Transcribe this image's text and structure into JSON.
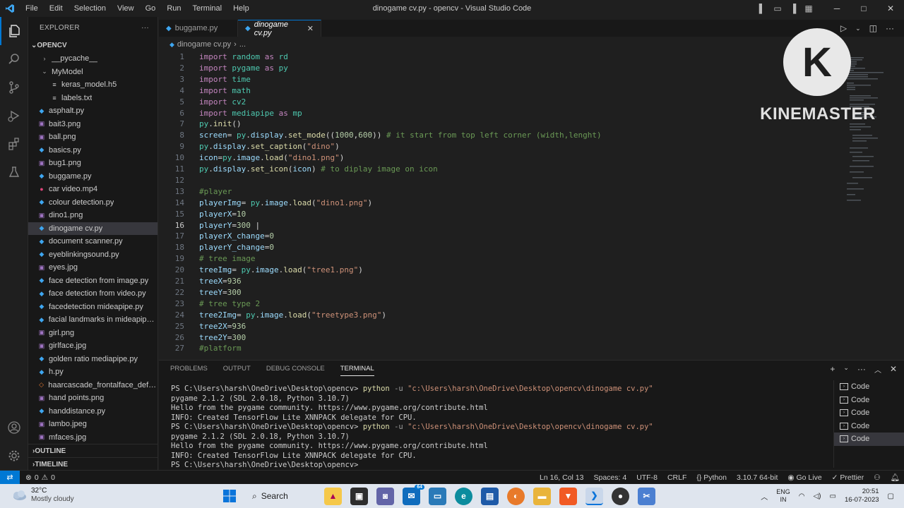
{
  "window": {
    "title": "dinogame cv.py - opencv - Visual Studio Code",
    "menu": [
      "File",
      "Edit",
      "Selection",
      "View",
      "Go",
      "Run",
      "Terminal",
      "Help"
    ]
  },
  "explorer": {
    "header": "EXPLORER",
    "root": "OPENCV",
    "items": [
      {
        "label": "__pycache__",
        "type": "folder-collapsed"
      },
      {
        "label": "MyModel",
        "type": "folder-open"
      },
      {
        "label": "keras_model.h5",
        "type": "file-h5"
      },
      {
        "label": "labels.txt",
        "type": "file-txt"
      },
      {
        "label": "asphalt.py",
        "type": "py"
      },
      {
        "label": "bait3.png",
        "type": "img"
      },
      {
        "label": "ball.png",
        "type": "img"
      },
      {
        "label": "basics.py",
        "type": "py"
      },
      {
        "label": "bug1.png",
        "type": "img"
      },
      {
        "label": "buggame.py",
        "type": "py"
      },
      {
        "label": "car video.mp4",
        "type": "video"
      },
      {
        "label": "colour detection.py",
        "type": "py"
      },
      {
        "label": "dino1.png",
        "type": "img"
      },
      {
        "label": "dinogame cv.py",
        "type": "py",
        "selected": true
      },
      {
        "label": "document scanner.py",
        "type": "py"
      },
      {
        "label": "eyeblinkingsound.py",
        "type": "py"
      },
      {
        "label": "eyes.jpg",
        "type": "img"
      },
      {
        "label": "face detection from image.py",
        "type": "py"
      },
      {
        "label": "face detection from video.py",
        "type": "py"
      },
      {
        "label": "facedetection mideapipe.py",
        "type": "py"
      },
      {
        "label": "facial landmarks in mideapipe ...",
        "type": "py"
      },
      {
        "label": "girl.png",
        "type": "img"
      },
      {
        "label": "girlface.jpg",
        "type": "img"
      },
      {
        "label": "golden ratio mediapipe.py",
        "type": "py"
      },
      {
        "label": "h.py",
        "type": "py"
      },
      {
        "label": "haarcascade_frontalface_defau...",
        "type": "xml"
      },
      {
        "label": "hand points.png",
        "type": "img"
      },
      {
        "label": "handdistance.py",
        "type": "py"
      },
      {
        "label": "lambo.jpeg",
        "type": "img"
      },
      {
        "label": "mfaces.jpg",
        "type": "img"
      }
    ],
    "outline": "OUTLINE",
    "timeline": "TIMELINE"
  },
  "tabs": [
    {
      "label": "buggame.py",
      "active": false
    },
    {
      "label": "dinogame cv.py",
      "active": true
    }
  ],
  "breadcrumb": [
    "dinogame cv.py",
    "..."
  ],
  "code_lines": [
    [
      [
        "k",
        "import "
      ],
      [
        "m",
        "random"
      ],
      [
        "k",
        " as "
      ],
      [
        "m",
        "rd"
      ]
    ],
    [
      [
        "k",
        "import "
      ],
      [
        "m",
        "pygame"
      ],
      [
        "k",
        " as "
      ],
      [
        "m",
        "py"
      ]
    ],
    [
      [
        "k",
        "import "
      ],
      [
        "m",
        "time"
      ]
    ],
    [
      [
        "k",
        "import "
      ],
      [
        "m",
        "math"
      ]
    ],
    [
      [
        "k",
        "import "
      ],
      [
        "m",
        "cv2"
      ]
    ],
    [
      [
        "k",
        "import "
      ],
      [
        "m",
        "mediapipe"
      ],
      [
        "k",
        " as "
      ],
      [
        "m",
        "mp"
      ]
    ],
    [
      [
        "m",
        "py"
      ],
      [
        "p",
        "."
      ],
      [
        "f",
        "init"
      ],
      [
        "p",
        "()"
      ]
    ],
    [
      [
        "v",
        "screen"
      ],
      [
        "p",
        "= "
      ],
      [
        "m",
        "py"
      ],
      [
        "p",
        "."
      ],
      [
        "v",
        "display"
      ],
      [
        "p",
        "."
      ],
      [
        "f",
        "set_mode"
      ],
      [
        "p",
        "(("
      ],
      [
        "n",
        "1000"
      ],
      [
        "p",
        ","
      ],
      [
        "n",
        "600"
      ],
      [
        "p",
        "))"
      ],
      [
        "c",
        " # it start from top left corner (width,lenght)"
      ]
    ],
    [
      [
        "m",
        "py"
      ],
      [
        "p",
        "."
      ],
      [
        "v",
        "display"
      ],
      [
        "p",
        "."
      ],
      [
        "f",
        "set_caption"
      ],
      [
        "p",
        "("
      ],
      [
        "s",
        "\"dino\""
      ],
      [
        "p",
        ")"
      ]
    ],
    [
      [
        "v",
        "icon"
      ],
      [
        "p",
        "="
      ],
      [
        "m",
        "py"
      ],
      [
        "p",
        "."
      ],
      [
        "v",
        "image"
      ],
      [
        "p",
        "."
      ],
      [
        "f",
        "load"
      ],
      [
        "p",
        "("
      ],
      [
        "s",
        "\"dino1.png\""
      ],
      [
        "p",
        ")"
      ]
    ],
    [
      [
        "m",
        "py"
      ],
      [
        "p",
        "."
      ],
      [
        "v",
        "display"
      ],
      [
        "p",
        "."
      ],
      [
        "f",
        "set_icon"
      ],
      [
        "p",
        "("
      ],
      [
        "v",
        "icon"
      ],
      [
        "p",
        ")"
      ],
      [
        "c",
        " # to diplay image on icon"
      ]
    ],
    [],
    [
      [
        "c",
        "#player"
      ]
    ],
    [
      [
        "v",
        "playerImg"
      ],
      [
        "p",
        "= "
      ],
      [
        "m",
        "py"
      ],
      [
        "p",
        "."
      ],
      [
        "v",
        "image"
      ],
      [
        "p",
        "."
      ],
      [
        "f",
        "load"
      ],
      [
        "p",
        "("
      ],
      [
        "s",
        "\"dino1.png\""
      ],
      [
        "p",
        ")"
      ]
    ],
    [
      [
        "v",
        "playerX"
      ],
      [
        "p",
        "="
      ],
      [
        "n",
        "10"
      ]
    ],
    [
      [
        "v",
        "playerY"
      ],
      [
        "p",
        "="
      ],
      [
        "n",
        "300"
      ],
      [
        "p",
        " |"
      ]
    ],
    [
      [
        "v",
        "playerX_change"
      ],
      [
        "p",
        "="
      ],
      [
        "n",
        "0"
      ]
    ],
    [
      [
        "v",
        "playerY_change"
      ],
      [
        "p",
        "="
      ],
      [
        "n",
        "0"
      ]
    ],
    [
      [
        "c",
        "# tree image"
      ]
    ],
    [
      [
        "v",
        "treeImg"
      ],
      [
        "p",
        "= "
      ],
      [
        "m",
        "py"
      ],
      [
        "p",
        "."
      ],
      [
        "v",
        "image"
      ],
      [
        "p",
        "."
      ],
      [
        "f",
        "load"
      ],
      [
        "p",
        "("
      ],
      [
        "s",
        "\"tree1.png\""
      ],
      [
        "p",
        ")"
      ]
    ],
    [
      [
        "v",
        "treeX"
      ],
      [
        "p",
        "="
      ],
      [
        "n",
        "936"
      ]
    ],
    [
      [
        "v",
        "treeY"
      ],
      [
        "p",
        "="
      ],
      [
        "n",
        "300"
      ]
    ],
    [
      [
        "c",
        "# tree type 2"
      ]
    ],
    [
      [
        "v",
        "tree2Img"
      ],
      [
        "p",
        "= "
      ],
      [
        "m",
        "py"
      ],
      [
        "p",
        "."
      ],
      [
        "v",
        "image"
      ],
      [
        "p",
        "."
      ],
      [
        "f",
        "load"
      ],
      [
        "p",
        "("
      ],
      [
        "s",
        "\"treetype3.png\""
      ],
      [
        "p",
        ")"
      ]
    ],
    [
      [
        "v",
        "tree2X"
      ],
      [
        "p",
        "="
      ],
      [
        "n",
        "936"
      ]
    ],
    [
      [
        "v",
        "tree2Y"
      ],
      [
        "p",
        "="
      ],
      [
        "n",
        "300"
      ]
    ],
    [
      [
        "c",
        "#platform"
      ]
    ]
  ],
  "current_line": 16,
  "watermark": {
    "letter": "K",
    "text": "KINEMASTER"
  },
  "panel": {
    "tabs": [
      "PROBLEMS",
      "OUTPUT",
      "DEBUG CONSOLE",
      "TERMINAL"
    ],
    "active_tab": "TERMINAL",
    "terminal_lines": [
      {
        "prompt": "PS C:\\Users\\harsh\\OneDrive\\Desktop\\opencv> ",
        "cmd": "python",
        "arg": " -u ",
        "str": "\"c:\\Users\\harsh\\OneDrive\\Desktop\\opencv\\dinogame cv.py\""
      },
      {
        "text": "pygame 2.1.2 (SDL 2.0.18, Python 3.10.7)"
      },
      {
        "text": "Hello from the pygame community. https://www.pygame.org/contribute.html"
      },
      {
        "text": "INFO: Created TensorFlow Lite XNNPACK delegate for CPU."
      },
      {
        "prompt": "PS C:\\Users\\harsh\\OneDrive\\Desktop\\opencv> ",
        "cmd": "python",
        "arg": " -u ",
        "str": "\"c:\\Users\\harsh\\OneDrive\\Desktop\\opencv\\dinogame cv.py\""
      },
      {
        "text": "pygame 2.1.2 (SDL 2.0.18, Python 3.10.7)"
      },
      {
        "text": "Hello from the pygame community. https://www.pygame.org/contribute.html"
      },
      {
        "text": "INFO: Created TensorFlow Lite XNNPACK delegate for CPU."
      },
      {
        "text": "PS C:\\Users\\harsh\\OneDrive\\Desktop\\opencv> "
      }
    ],
    "terminals": [
      "Code",
      "Code",
      "Code",
      "Code",
      "Code"
    ]
  },
  "statusbar": {
    "problems": "0",
    "warnings": "0",
    "position": "Ln 16, Col 13",
    "spaces": "Spaces: 4",
    "encoding": "UTF-8",
    "eol": "CRLF",
    "language": "Python",
    "interpreter": "3.10.7 64-bit",
    "golive": "Go Live",
    "prettier": "Prettier"
  },
  "taskbar": {
    "temperature": "32°C",
    "condition": "Mostly cloudy",
    "search": "Search",
    "badge": "64",
    "lang_top": "ENG",
    "lang_bottom": "IN",
    "time": "20:51",
    "date": "16-07-2023"
  }
}
